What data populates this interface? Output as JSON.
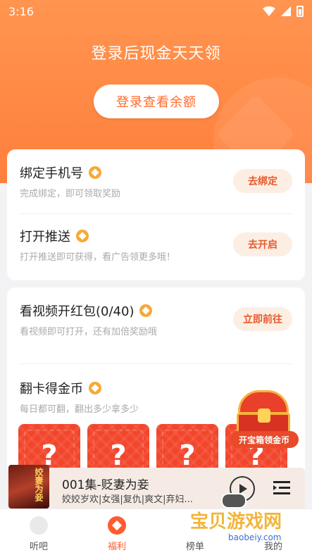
{
  "status_bar": {
    "time": "3:16"
  },
  "hero": {
    "title": "登录后现金天天领",
    "login_button": "登录查看余额"
  },
  "tasks_card1": [
    {
      "title": "绑定手机号",
      "desc": "完成绑定，即可领取奖励",
      "button": "去绑定"
    },
    {
      "title": "打开推送",
      "desc": "打开推送即可获得，看广告领更多哦！",
      "button": "去开启"
    }
  ],
  "tasks_card2": [
    {
      "title": "看视频开红包(0/40)",
      "desc": "看视频即可打开，还有加倍奖励哦",
      "button": "立即前往"
    },
    {
      "title": "翻卡得金币",
      "desc": "每日都可翻，翻出多少拿多少"
    }
  ],
  "flip_cards": [
    "?",
    "?",
    "?",
    "?"
  ],
  "treasure_label": "开宝箱领金币",
  "player": {
    "cover_text": "姣妻为妾",
    "title": "001集-贬妻为妾",
    "tags": "姣姣岁欢|女强|复仇|爽文|弃妇..."
  },
  "tabbar": {
    "listen": "听吧",
    "welfare": "福利",
    "rank": "榜单",
    "mine": "我的"
  },
  "watermark": {
    "text": "宝贝游戏网",
    "url": "baobeiy.com"
  },
  "colors": {
    "accent": "#ff6a2c",
    "header": "#ff8a48",
    "flip_card": "#f2462c"
  }
}
